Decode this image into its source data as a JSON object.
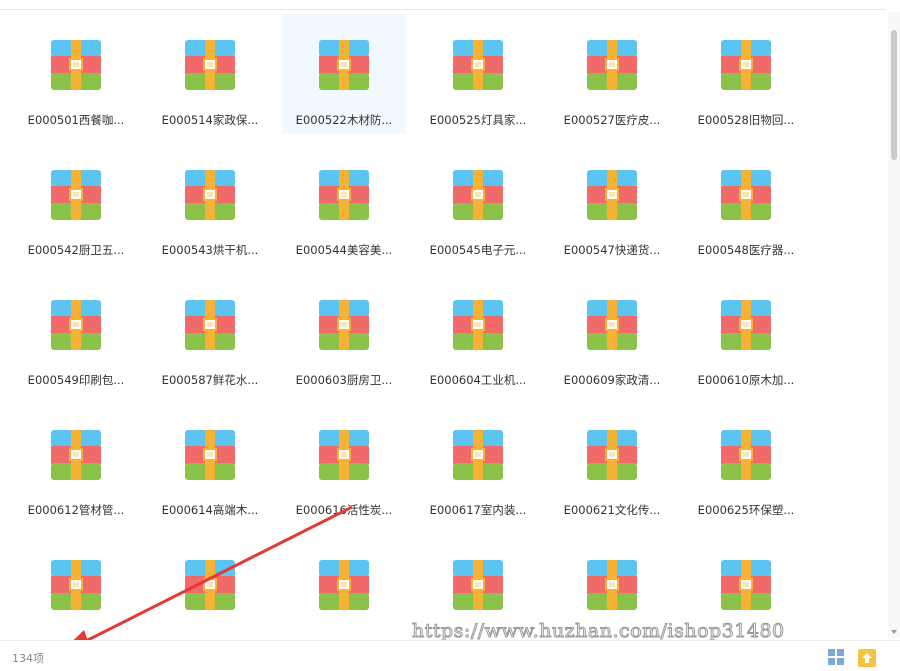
{
  "files": [
    "E000501西餐咖...",
    "E000514家政保...",
    "E000522木材防...",
    "E000525灯具家...",
    "E000527医疗皮...",
    "E000528旧物回...",
    "E000542厨卫五...",
    "E000543烘干机...",
    "E000544美容美...",
    "E000545电子元...",
    "E000547快递货...",
    "E000548医疗器...",
    "E000549印刷包...",
    "E000587鲜花水...",
    "E000603厨房卫...",
    "E000604工业机...",
    "E000609家政清...",
    "E000610原木加...",
    "E000612管材管...",
    "E000614高端木...",
    "E000616活性炭...",
    "E000617室内装...",
    "E000621文化传...",
    "E000625环保塑...",
    "",
    "",
    "",
    "",
    "",
    ""
  ],
  "selected_index": 2,
  "status": {
    "count_label": "134项"
  },
  "watermark": "https://www.huzhan.com/ishop31480",
  "colors": {
    "icon_blue": "#5bc4f1",
    "icon_red": "#f06a6a",
    "icon_green": "#8bc34a",
    "icon_strap": "#f5b235",
    "arrow": "#e53935"
  },
  "icons": {
    "file": "archive-icon",
    "view": "grid-view-icon",
    "upload": "upload-icon"
  }
}
